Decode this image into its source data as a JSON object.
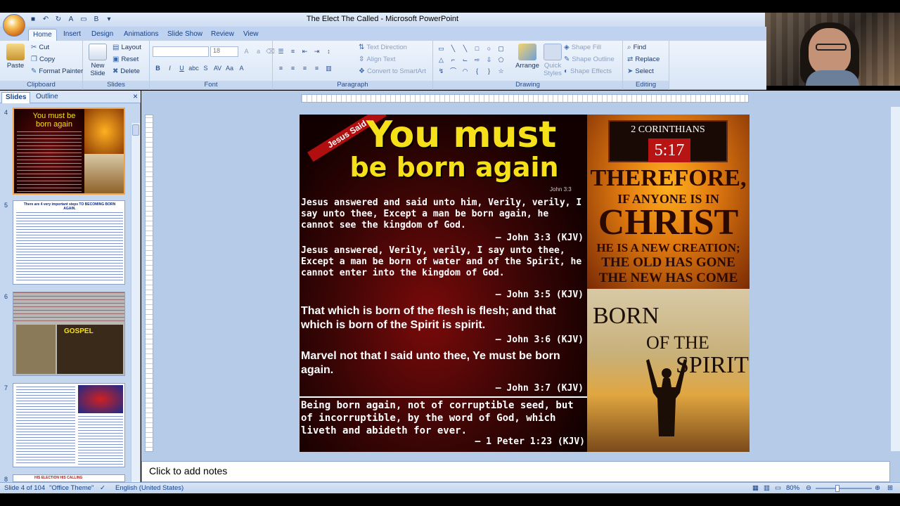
{
  "window": {
    "title": "The Elect The Called - Microsoft PowerPoint"
  },
  "ribbon": {
    "tabs": [
      "Home",
      "Insert",
      "Design",
      "Animations",
      "Slide Show",
      "Review",
      "View"
    ],
    "clipboard": {
      "paste": "Paste",
      "cut": "Cut",
      "copy": "Copy",
      "format_painter": "Format Painter",
      "label": "Clipboard"
    },
    "slides": {
      "new_slide": "New Slide",
      "layout": "Layout",
      "reset": "Reset",
      "delete": "Delete",
      "label": "Slides"
    },
    "font": {
      "size": "18",
      "label": "Font"
    },
    "paragraph": {
      "text_direction": "Text Direction",
      "align_text": "Align Text",
      "smartart": "Convert to SmartArt",
      "label": "Paragraph"
    },
    "drawing": {
      "arrange": "Arrange",
      "quick_styles": "Quick Styles",
      "shape_fill": "Shape Fill",
      "shape_outline": "Shape Outline",
      "shape_effects": "Shape Effects",
      "label": "Drawing"
    },
    "editing": {
      "find": "Find",
      "replace": "Replace",
      "select": "Select",
      "label": "Editing"
    }
  },
  "pane": {
    "tab_slides": "Slides",
    "tab_outline": "Outline",
    "close": "×"
  },
  "thumbnails": [
    {
      "num": "4",
      "title": "You must be born again"
    },
    {
      "num": "5",
      "title": "There are 4 very important steps TO BECOMING BORN AGAIN."
    },
    {
      "num": "6",
      "title": "GOSPEL"
    },
    {
      "num": "7",
      "title": ""
    },
    {
      "num": "8",
      "title": "HIS ELECTION HIS CALLING"
    }
  ],
  "slide": {
    "jesus_said": "Jesus Said",
    "heading_line1": "You must",
    "heading_line2": "be born again",
    "heading_ref": "John 3:3",
    "verse1": "Jesus answered and said unto him, Verily, verily, I say unto thee, Except a man be born again, he cannot see the kingdom of God.",
    "ref1": "— John 3:3 (KJV)",
    "verse2": "Jesus answered, Verily, verily, I say unto thee, Except a man be born of water and of the Spirit, he cannot enter into the kingdom of God.",
    "ref2": "— John 3:5 (KJV)",
    "verse3": "That which is born of the flesh is flesh; and that which is born of the Spirit is spirit.",
    "ref3": "— John 3:6 (KJV)",
    "verse4": "Marvel not that I said unto thee, Ye must be born again.",
    "ref4": "— John 3:7 (KJV)",
    "verse5": "Being born again, not of corruptible seed, but of incorruptible, by the word of God, which liveth and abideth for ever.",
    "ref5": "— 1 Peter 1:23 (KJV)",
    "cor_title": "2 CORINTHIANS",
    "cor_ref": "5:17",
    "cor_line1": "THEREFORE,",
    "cor_line2": "IF ANYONE IS IN",
    "cor_line3": "CHRIST",
    "cor_line4": "HE IS A NEW CREATION;",
    "cor_line5": "THE OLD HAS GONE",
    "cor_line6": "THE NEW HAS COME",
    "born_line1": "BORN",
    "born_line2": "OF THE",
    "born_line3": "SPIRIT"
  },
  "notes": {
    "placeholder": "Click to add notes"
  },
  "status": {
    "slide": "Slide 4 of 104",
    "theme": "\"Office Theme\"",
    "language": "English (United States)",
    "zoom": "80%"
  },
  "colors": {
    "heading": "#f6e01a",
    "ribbon": "#d8e5f6",
    "cor_ref_bg": "#b81414"
  }
}
